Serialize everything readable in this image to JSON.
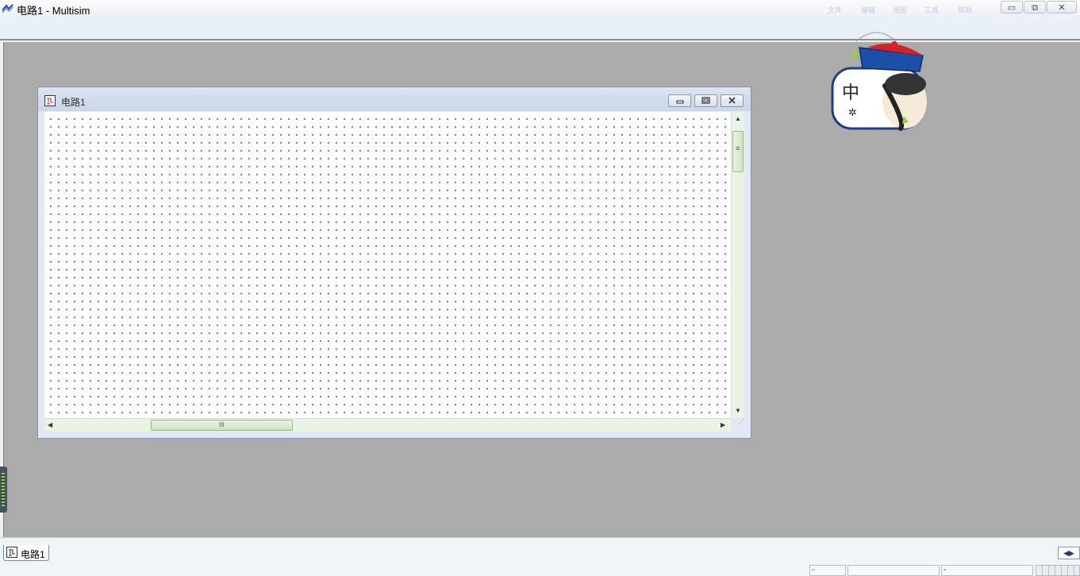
{
  "app": {
    "title": "电路1 - Multisim",
    "ghost_menu": [
      "文件",
      "编辑",
      "视图",
      "工具",
      "帮助"
    ],
    "window_controls": {
      "minimize": "▭",
      "restore": "⧉",
      "close": "✕"
    }
  },
  "document": {
    "title": "电路1",
    "controls": {
      "minimize": "minimize-icon",
      "restore": "restore-icon",
      "close": "close-icon"
    }
  },
  "tabs": [
    {
      "label": "电路1",
      "active": true
    }
  ],
  "tab_scroll": {
    "left": "◀",
    "right": "▶"
  },
  "status_bar": {
    "fields": [
      "-",
      "",
      "-"
    ]
  },
  "scroll": {
    "vertical_thumb_grip": "≡",
    "horizontal_thumb_grip": "III"
  },
  "ime": {
    "char": "中",
    "settings_glyph": "✲"
  },
  "colors": {
    "workspace": "#ababab",
    "canvas": "#ffffff",
    "scroll_track": "#eaf4e6",
    "title_accent": "#c9d6e6",
    "ime_hat_red": "#d4212a",
    "ime_hat_blue": "#1c4fa8"
  }
}
